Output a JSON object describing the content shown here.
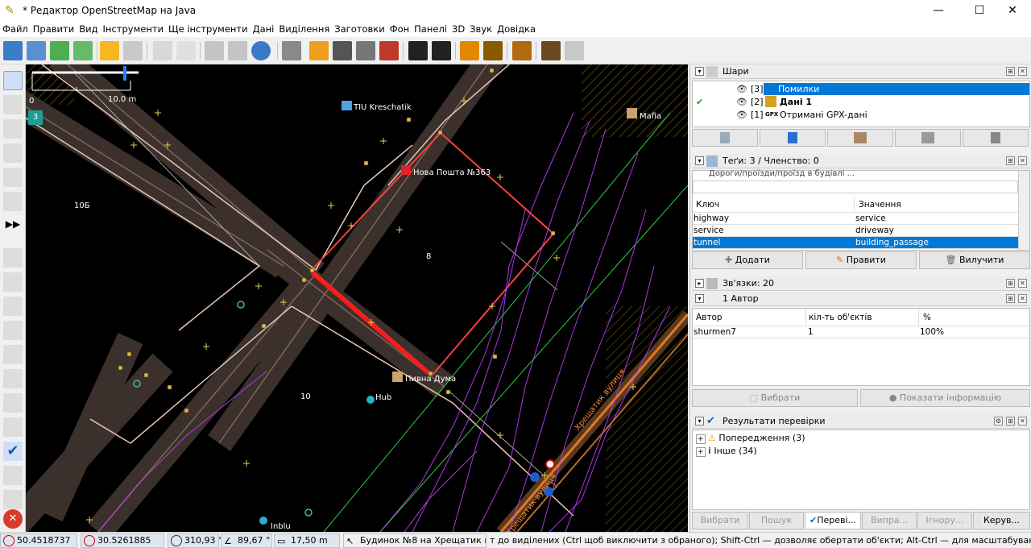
{
  "window": {
    "title": "* Редактор OpenStreetMap на Java"
  },
  "menu": [
    "Файл",
    "Правити",
    "Вид",
    "Інструменти",
    "Ще інструменти",
    "Дані",
    "Виділення",
    "Заготовки",
    "Фон",
    "Панелі",
    "3D",
    "Звук",
    "Довідка"
  ],
  "map": {
    "scale_start": "0",
    "scale_end": "10.0 m",
    "badge": "3",
    "labels": {
      "tiu": "TIU Kreschatik",
      "mafia": "Mafia",
      "nova": "Нова Пошта №363",
      "house_10b": "10Б",
      "house_8": "8",
      "pivna": "Пивна Дума",
      "house_10": "10",
      "hub": "Hub",
      "inblu": "Inblu",
      "street1": "Хрещатик вулиця",
      "street2": "Хрещатик вулиця"
    }
  },
  "layers": {
    "title": "Шари",
    "items": [
      {
        "index": "[3]",
        "name": "Помилки"
      },
      {
        "index": "[2]",
        "name": "Дані 1"
      },
      {
        "index": "[1]",
        "name": "Отримані GPX-дані",
        "prefix": "GPX"
      }
    ]
  },
  "tags": {
    "title": "Теґи: 3 / Членство: 0",
    "preset": "Дороги/проїзди/проїзд в будівлі ...",
    "col_key": "Ключ",
    "col_value": "Значення",
    "rows": [
      {
        "key": "highway",
        "value": "service"
      },
      {
        "key": "service",
        "value": "driveway"
      },
      {
        "key": "tunnel",
        "value": "building_passage"
      }
    ],
    "btn_add": "Додати",
    "btn_edit": "Правити",
    "btn_delete": "Вилучити"
  },
  "relations": {
    "title": "Зв'язки: 20"
  },
  "authors": {
    "title": "1 Автор",
    "col_author": "Автор",
    "col_count": "кіл-ть об'єктів",
    "col_pct": "%",
    "rows": [
      {
        "author": "shurmen7",
        "count": "1",
        "pct": "100%"
      }
    ],
    "btn_select": "Вибрати",
    "btn_info": "Показати інформацію"
  },
  "validation": {
    "title": "Результати перевірки",
    "items": [
      {
        "label": "Попередження (3)"
      },
      {
        "label": "Інше (34)"
      }
    ]
  },
  "bottom_tabs": [
    "Вибрати",
    "Пошук",
    "Переві...",
    "Випра...",
    "Ігнору...",
    "Керув..."
  ],
  "status": {
    "lat": "50.4518737",
    "lon": "30.5261885",
    "heading": "310,93 °",
    "angle": "89,67 °",
    "length": "17,50 m",
    "name": "Будинок №8 на Хрещатик ву...",
    "help": "т до виділених (Ctrl щоб виключити з обраного); Shift-Ctrl — дозволяє обертати об'єкти; Alt-Ctrl — для масштабування; або виділіть інше"
  },
  "colors": {
    "selection": "#0078d7",
    "selected_way": "#ff2a2a",
    "gpx": "#c000ff",
    "road": "#3a302c"
  }
}
